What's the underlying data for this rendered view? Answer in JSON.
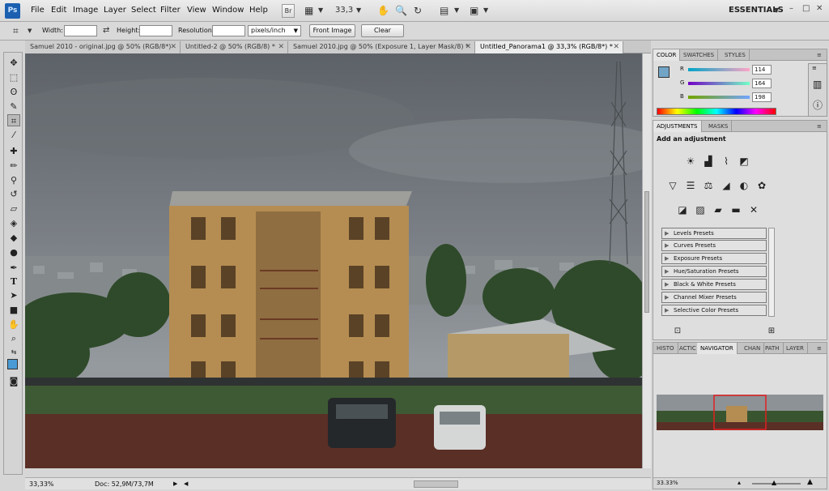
{
  "app": {
    "logo": "Ps"
  },
  "menu": [
    "File",
    "Edit",
    "Image",
    "Layer",
    "Select",
    "Filter",
    "View",
    "Window",
    "Help"
  ],
  "menubar": {
    "bridge": "Br",
    "zoom": "33,3",
    "workspace": "ESSENTIALS",
    "minimize": "–",
    "restore": "□",
    "close": "✕"
  },
  "options": {
    "width_label": "Width:",
    "height_label": "Height:",
    "resolution_label": "Resolution:",
    "units": "pixels/inch",
    "front_image": "Front Image",
    "clear": "Clear"
  },
  "doc_tabs": [
    "Samuel 2010 - original.jpg @ 50% (RGB/8*)",
    "Untitled-2 @ 50% (RGB/8) *",
    "Samuel 2010.jpg @ 50% (Exposure 1, Layer Mask/8) *",
    "Untitled_Panorama1 @ 33,3% (RGB/8*) *"
  ],
  "status": {
    "zoom": "33,33%",
    "doc": "Doc: 52,9M/73,7M"
  },
  "color_panel": {
    "tabs": [
      "COLOR",
      "SWATCHES",
      "STYLES"
    ],
    "r_label": "R",
    "g_label": "G",
    "b_label": "B",
    "r": "114",
    "g": "164",
    "b": "198",
    "fg_color": "#72a4c6"
  },
  "adjustments_panel": {
    "tabs": [
      "ADJUSTMENTS",
      "MASKS"
    ],
    "heading": "Add an adjustment",
    "presets": [
      "Levels Presets",
      "Curves Presets",
      "Exposure Presets",
      "Hue/Saturation Presets",
      "Black & White Presets",
      "Channel Mixer Presets",
      "Selective Color Presets"
    ]
  },
  "navigator_panel": {
    "tabs": [
      "HISTO",
      "ACTIC",
      "NAVIGATOR",
      "CHAN",
      "PATH",
      "LAYER"
    ],
    "zoom": "33.33%"
  }
}
